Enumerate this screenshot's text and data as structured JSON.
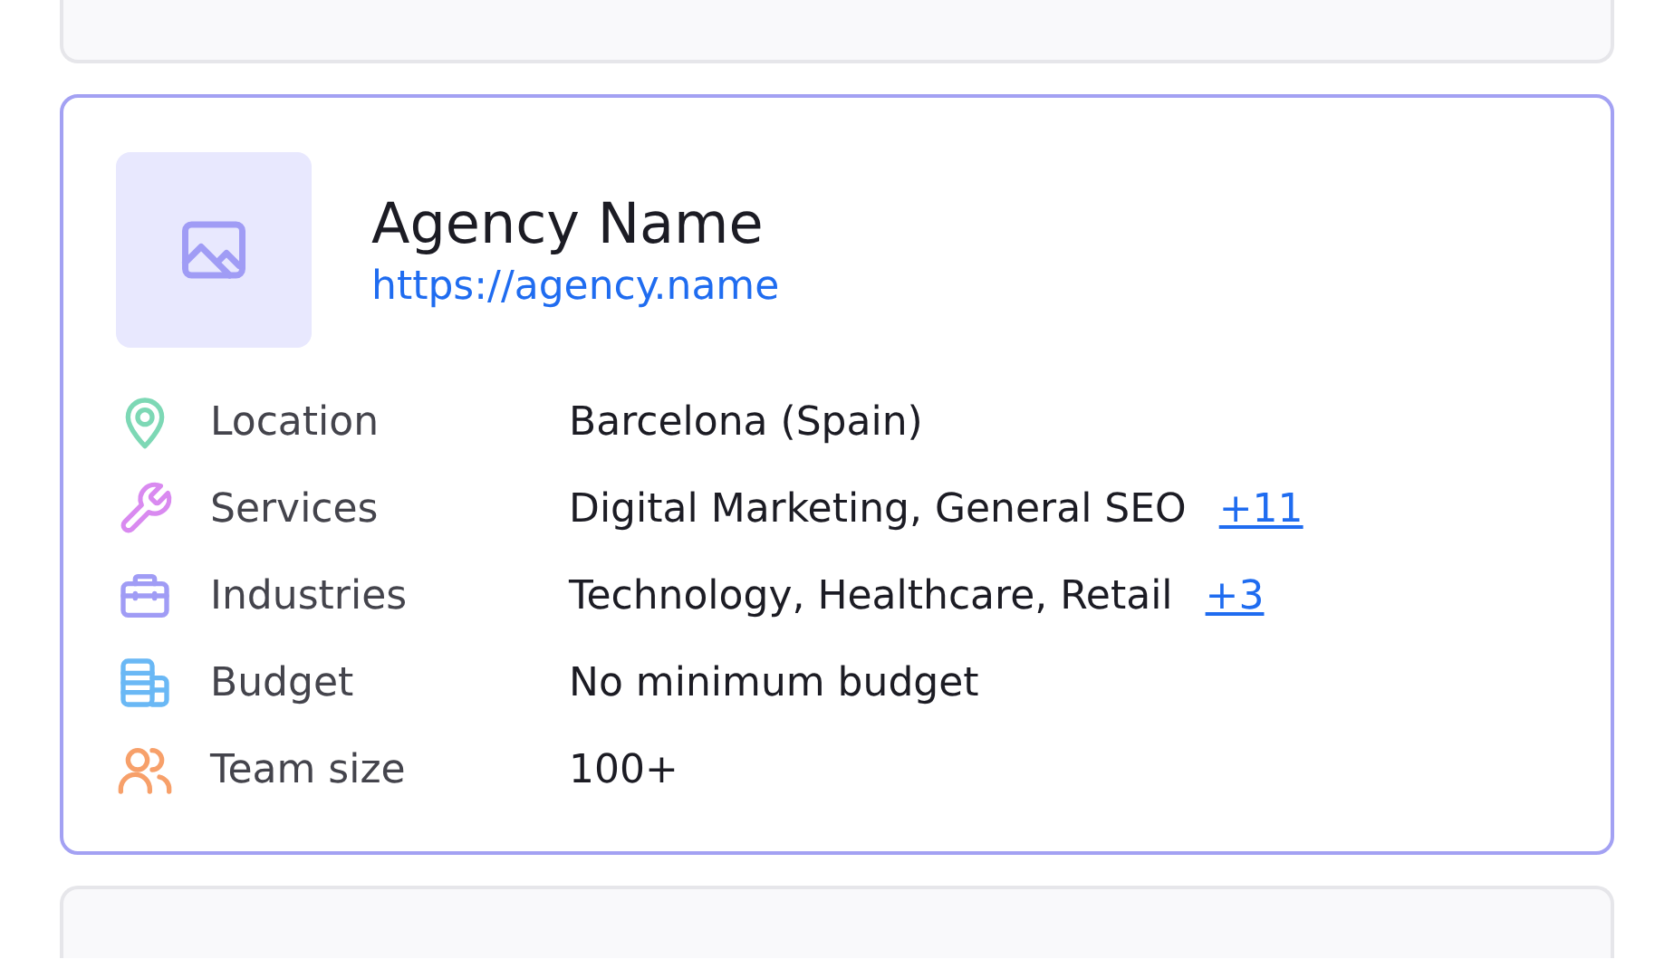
{
  "agency": {
    "name": "Agency Name",
    "url": "https://agency.name"
  },
  "details": [
    {
      "kind": "location",
      "label": "Location",
      "value": "Barcelona (Spain)",
      "color": "#7dd8b5"
    },
    {
      "kind": "services",
      "label": "Services",
      "value": "Digital Marketing, General SEO",
      "more": "+11",
      "color": "#d98af0"
    },
    {
      "kind": "industries",
      "label": "Industries",
      "value": "Technology, Healthcare, Retail",
      "more": "+3",
      "color": "#a09cf5"
    },
    {
      "kind": "budget",
      "label": "Budget",
      "value": "No minimum budget",
      "color": "#6ab8f5"
    },
    {
      "kind": "team",
      "label": "Team size",
      "value": "100+",
      "color": "#f7a06a"
    }
  ]
}
